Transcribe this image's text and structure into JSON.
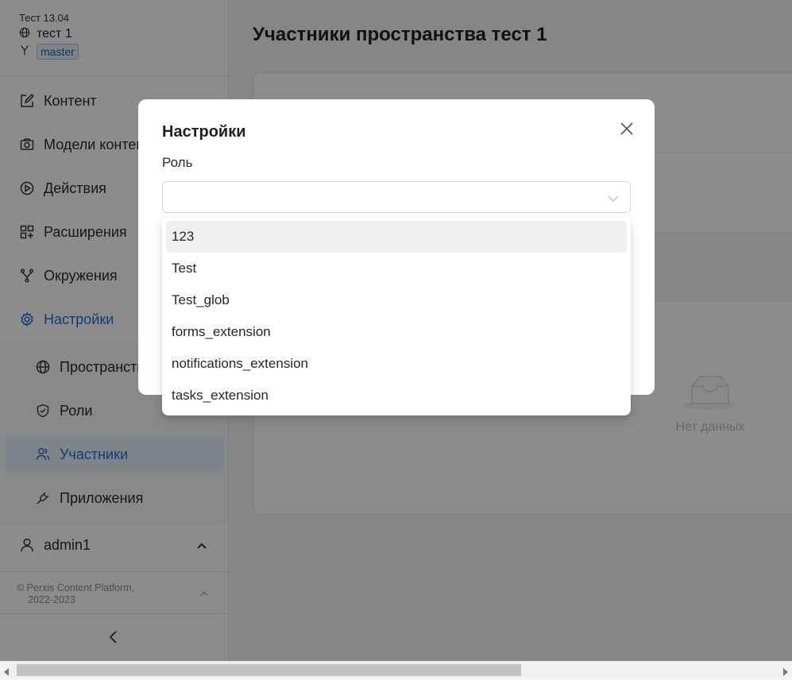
{
  "sidebar": {
    "org_name": "Тест 13.04",
    "space_name": "тест 1",
    "environment": "master",
    "menu": [
      {
        "label": "Контент",
        "icon": "edit-icon"
      },
      {
        "label": "Модели контента",
        "icon": "camera-icon"
      },
      {
        "label": "Действия",
        "icon": "play-circle-icon"
      },
      {
        "label": "Расширения",
        "icon": "apps-icon"
      },
      {
        "label": "Окружения",
        "icon": "branch-icon"
      },
      {
        "label": "Настройки",
        "icon": "gear-icon"
      }
    ],
    "submenu": [
      {
        "label": "Пространство",
        "icon": "globe-icon"
      },
      {
        "label": "Роли",
        "icon": "shield-icon"
      },
      {
        "label": "Участники",
        "icon": "users-icon"
      },
      {
        "label": "Приложения",
        "icon": "plug-icon"
      }
    ],
    "user": "admin1",
    "copyright_line1": "© Perxis Content Platform,",
    "copyright_line2": "2022-2023"
  },
  "main": {
    "title": "Участники пространства тест 1",
    "empty_text": "Нет данных"
  },
  "modal": {
    "title": "Настройки",
    "role_label": "Роль",
    "role_value": "",
    "options": [
      "123",
      "Test",
      "Test_glob",
      "forms_extension",
      "notifications_extension",
      "tasks_extension"
    ],
    "hovered_option": "123"
  },
  "colors": {
    "accent": "#1f6fd8",
    "selected_bg": "#e6f0fb"
  }
}
